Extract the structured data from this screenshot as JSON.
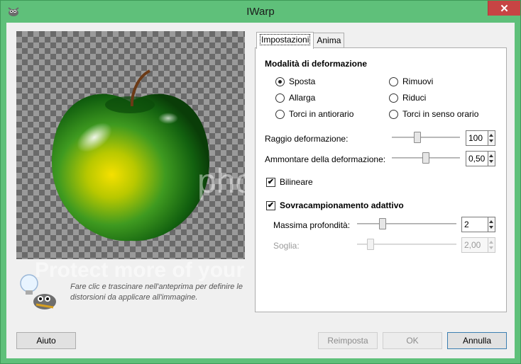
{
  "window": {
    "title": "IWarp",
    "close_glyph": "✕",
    "icon": "gimp-wilber-icon"
  },
  "preview": {
    "hint": "Fare clic e trascinare nell'anteprima per definire le distorsioni da applicare all'immagine.",
    "watermark_main": "Protect more of your",
    "watermark_logo": "pho"
  },
  "tabs": [
    {
      "label": "Impostazioni",
      "active": true
    },
    {
      "label": "Anima",
      "active": false
    }
  ],
  "settings": {
    "mode_title": "Modalità di deformazione",
    "modes": [
      {
        "label": "Sposta",
        "selected": true
      },
      {
        "label": "Rimuovi",
        "selected": false
      },
      {
        "label": "Allarga",
        "selected": false
      },
      {
        "label": "Riduci",
        "selected": false
      },
      {
        "label": "Torci in antiorario",
        "selected": false
      },
      {
        "label": "Torci in senso orario",
        "selected": false
      }
    ],
    "radius": {
      "label": "Raggio deformazione:",
      "value": "100",
      "level": 0.3
    },
    "amount": {
      "label": "Ammontare della deformazione:",
      "value": "0,50",
      "level": 0.5
    },
    "bilinear": {
      "label": "Bilineare",
      "checked": true
    },
    "supersample": {
      "label": "Sovracampionamento adattivo",
      "checked": true
    },
    "depth": {
      "label": "Massima profondità:",
      "value": "2",
      "level": 0.2
    },
    "threshold": {
      "label": "Soglia:",
      "value": "2,00",
      "level": 0.1
    }
  },
  "buttons": {
    "help": "Aiuto",
    "reset": "Reimposta",
    "ok": "OK",
    "cancel": "Annulla"
  },
  "colors": {
    "frame": "#5fc07a",
    "close": "#c74444"
  }
}
